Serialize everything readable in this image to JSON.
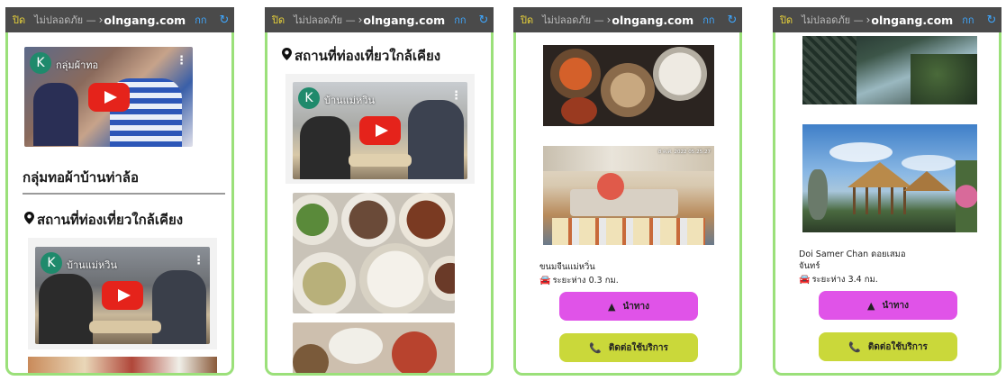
{
  "browser": {
    "close_label": "ปิด",
    "insecure_label": "ไม่ปลอดภัย —",
    "domain_prefix": "›",
    "domain": "olngang.com",
    "translate_label": "กก",
    "reload_glyph": "↻"
  },
  "screen1": {
    "video1": {
      "avatar_letter": "K",
      "title": "กลุ่มผ้าทอ"
    },
    "group_title": "กลุ่มทอผ้าบ้านท่าล้อ",
    "nearby_heading": "สถานที่ท่องเที่ยวใกล้เคียง",
    "video2": {
      "avatar_letter": "K",
      "title": "บ้านแม่หวิน"
    }
  },
  "screen2": {
    "nearby_heading": "สถานที่ท่องเที่ยวใกล้เคียง",
    "video": {
      "avatar_letter": "K",
      "title": "บ้านแม่หวิน"
    }
  },
  "screen3": {
    "place_name": "ขนมจีนแม่หวิ่น",
    "distance": "ระยะห่าง 0.3 กม.",
    "nav_label": "นำทาง",
    "call_label": "ติดต่อใช้บริการ",
    "photo_stamp": "8 ค.ศ. 2022 05:25:27"
  },
  "screen4": {
    "place_name": "Doi Samer Chan ดอยเสมอ",
    "place_name_2": "จันทร์",
    "distance": "ระยะห่าง 3.4 กม.",
    "nav_label": "นำทาง",
    "call_label": "ติดต่อใช้บริการ"
  },
  "icons": {
    "pin": "📍",
    "car": "🚘",
    "navigate": "▲",
    "phone": "📞",
    "kebab": "⋮"
  },
  "colors": {
    "frame_green": "#9be07a",
    "nav_magenta": "#e053e8",
    "call_lime": "#cad83a",
    "youtube_red": "#e5231b",
    "avatar_teal": "#1f8a6c"
  }
}
